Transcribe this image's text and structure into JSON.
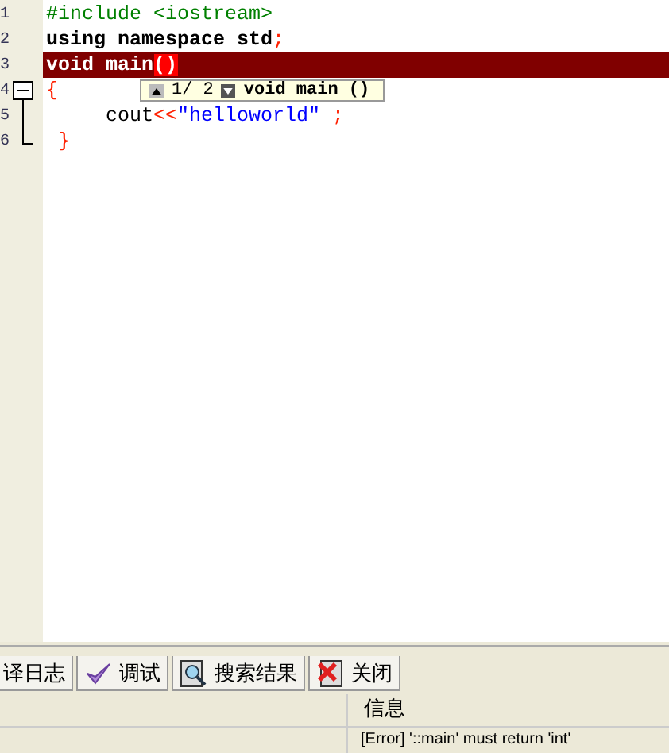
{
  "editor": {
    "lines": [
      {
        "number": "1",
        "highlighted": false,
        "kind": "plain",
        "tokens": [
          {
            "kind": "preprocessor",
            "text": "#include <iostream>"
          }
        ]
      },
      {
        "number": "2",
        "highlighted": false,
        "kind": "plain",
        "tokens": [
          {
            "kind": "keyword",
            "text": "using namespace std"
          },
          {
            "kind": "symbol",
            "text": ";"
          }
        ]
      },
      {
        "number": "3",
        "highlighted": true,
        "kind": "plain",
        "tokens": [
          {
            "kind": "keyword",
            "text": "void main"
          },
          {
            "kind": "match",
            "text": "()"
          }
        ]
      },
      {
        "number": "4",
        "highlighted": false,
        "kind": "fold-start",
        "tokens": [
          {
            "kind": "symbol",
            "text": "{"
          }
        ]
      },
      {
        "number": "5",
        "highlighted": false,
        "kind": "fold-body",
        "tokens": [
          {
            "kind": "plain",
            "text": "     cout"
          },
          {
            "kind": "symbol",
            "text": "<<"
          },
          {
            "kind": "string",
            "text": "\"helloworld\""
          },
          {
            "kind": "symbol",
            "text": " ;"
          }
        ]
      },
      {
        "number": "6",
        "highlighted": false,
        "kind": "fold-end",
        "tokens": [
          {
            "kind": "symbol",
            "text": " }"
          }
        ]
      }
    ],
    "tooltip": {
      "counter": "1/ 2",
      "signature": "void main ()"
    }
  },
  "tabs": [
    {
      "label": "译日志",
      "kind": "log",
      "selected": false
    },
    {
      "label": "调试",
      "kind": "debug",
      "selected": false
    },
    {
      "label": "搜索结果",
      "kind": "search",
      "selected": false
    },
    {
      "label": "关闭",
      "kind": "close",
      "selected": false
    }
  ],
  "messages": {
    "columns": [
      "信息"
    ],
    "rows": [
      {
        "message": "[Error] '::main' must return 'int'"
      }
    ]
  }
}
